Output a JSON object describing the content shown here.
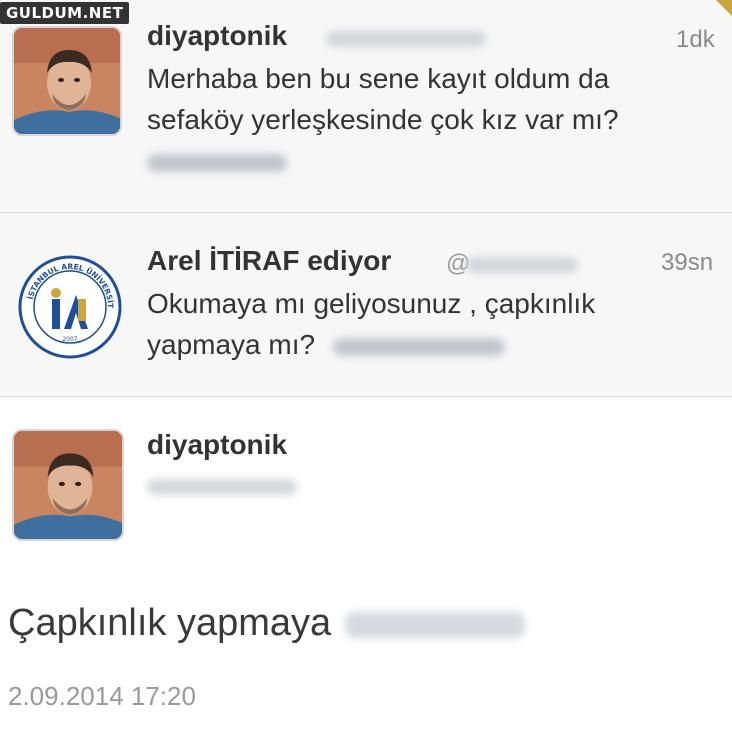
{
  "watermark": "GULDUM.NET",
  "tweets": [
    {
      "name": "diyaptonik",
      "time": "1dk",
      "lines": [
        "Merhaba ben bu sene kayıt oldum da",
        "sefaköy yerleşkesinde çok kız var mı?"
      ]
    },
    {
      "name": "Arel İTİRAF ediyor",
      "handle_prefix": "@",
      "time": "39sn",
      "lines": [
        "Okumaya mı geliyosunuz , çapkınlık",
        "yapmaya mı?"
      ]
    }
  ],
  "detail": {
    "name": "diyaptonik",
    "text": "Çapkınlık yapmaya",
    "timestamp": "2.09.2014 17:20"
  },
  "logo": {
    "ring_text": "İSTANBUL AREL ÜNİVERSİTESİ",
    "year": "2007"
  },
  "colors": {
    "tweet_bg": "#f7f7f8",
    "logo_blue": "#1f4e9a",
    "logo_gold": "#c9a640",
    "text": "#333333",
    "muted": "#8a8a8a"
  }
}
